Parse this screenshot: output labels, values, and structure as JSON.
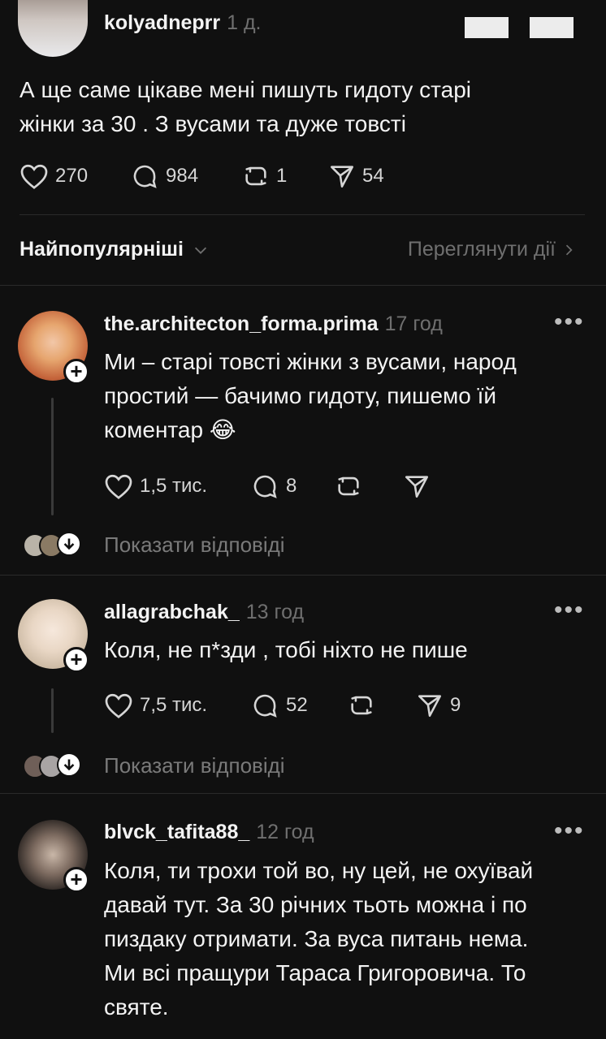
{
  "post": {
    "username": "kolyadneprr",
    "time": "1 д.",
    "text_line1": "А ще саме цікаве мені пишуть гидоту старі",
    "text_line2": "жінки за 30 . З вусами та дуже товсті",
    "likes": "270",
    "replies": "984",
    "reposts": "1",
    "shares": "54"
  },
  "sort_bar": {
    "sort_label": "Найпопулярніші",
    "view_activity": "Переглянути дії"
  },
  "comments": [
    {
      "username": "the.architecton_forma.prima",
      "time": "17 год",
      "lines": [
        "Ми – старі товсті жінки з вусами, народ",
        "простий — бачимо гидоту, пишемо їй",
        "коментар 😂"
      ],
      "likes": "1,5 тис.",
      "replies": "8",
      "show_replies": "Показати відповіді"
    },
    {
      "username": "allagrabchak_",
      "time": "13 год",
      "lines": [
        "Коля, не п*зди , тобі ніхто не пише"
      ],
      "likes": "7,5 тис.",
      "replies": "52",
      "shares": "9",
      "show_replies": "Показати відповіді"
    },
    {
      "username": "blvck_tafita88_",
      "time": "12 год",
      "lines": [
        "Коля, ти трохи той во, ну цей, не охуївай",
        "давай тут. За 30 річних тьоть можна і по",
        "пиздаку отримати. За вуса питань нема.",
        "Ми всі пращури Тараса Григоровича. То",
        "святе."
      ]
    }
  ],
  "colors": {
    "background": "#101010",
    "text": "#f3f3f3",
    "muted": "#6f6f6f"
  }
}
